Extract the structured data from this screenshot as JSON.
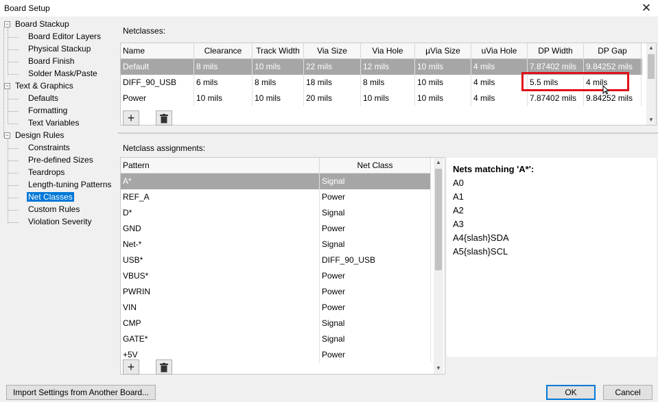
{
  "window": {
    "title": "Board Setup",
    "close_glyph": "✕"
  },
  "tree": [
    {
      "label": "Board Stackup",
      "level": 0,
      "expander": "−"
    },
    {
      "label": "Board Editor Layers",
      "level": 1
    },
    {
      "label": "Physical Stackup",
      "level": 1
    },
    {
      "label": "Board Finish",
      "level": 1
    },
    {
      "label": "Solder Mask/Paste",
      "level": 1
    },
    {
      "label": "Text & Graphics",
      "level": 0,
      "expander": "−"
    },
    {
      "label": "Defaults",
      "level": 1
    },
    {
      "label": "Formatting",
      "level": 1
    },
    {
      "label": "Text Variables",
      "level": 1
    },
    {
      "label": "Design Rules",
      "level": 0,
      "expander": "−"
    },
    {
      "label": "Constraints",
      "level": 1
    },
    {
      "label": "Pre-defined Sizes",
      "level": 1
    },
    {
      "label": "Teardrops",
      "level": 1
    },
    {
      "label": "Length-tuning Patterns",
      "level": 1
    },
    {
      "label": "Net Classes",
      "level": 1,
      "selected": true
    },
    {
      "label": "Custom Rules",
      "level": 1
    },
    {
      "label": "Violation Severity",
      "level": 1
    }
  ],
  "netclasses": {
    "label": "Netclasses:",
    "columns": [
      "Name",
      "Clearance",
      "Track Width",
      "Via Size",
      "Via Hole",
      "µVia Size",
      "uVia Hole",
      "DP Width",
      "DP Gap"
    ],
    "rows": [
      [
        "Default",
        "8 mils",
        "10 mils",
        "22 mils",
        "12 mils",
        "10 mils",
        "4 mils",
        "7.87402 mils",
        "9.84252 mils"
      ],
      [
        "DIFF_90_USB",
        "6 mils",
        "8 mils",
        "18 mils",
        "8 mils",
        "10 mils",
        "4 mils",
        "5.5 mils",
        "4 mils"
      ],
      [
        "Power",
        "10 mils",
        "10 mils",
        "20 mils",
        "10 mils",
        "10 mils",
        "4 mils",
        "7.87402 mils",
        "9.84252 mils"
      ]
    ],
    "selected_row": 0,
    "add_glyph": "+",
    "scroll_up": "▲",
    "scroll_down": "▼"
  },
  "assignments": {
    "label": "Netclass assignments:",
    "columns": [
      "Pattern",
      "Net Class"
    ],
    "rows": [
      [
        "A*",
        "Signal"
      ],
      [
        "REF_A",
        "Power"
      ],
      [
        "D*",
        "Signal"
      ],
      [
        "GND",
        "Power"
      ],
      [
        "Net-*",
        "Signal"
      ],
      [
        "USB*",
        "DIFF_90_USB"
      ],
      [
        "VBUS*",
        "Power"
      ],
      [
        "PWRIN",
        "Power"
      ],
      [
        "VIN",
        "Power"
      ],
      [
        "CMP",
        "Signal"
      ],
      [
        "GATE*",
        "Signal"
      ],
      [
        "+5V",
        "Power"
      ]
    ],
    "selected_row": 0,
    "add_glyph": "+",
    "scroll_up": "▲",
    "scroll_down": "▼"
  },
  "preview": {
    "title": "Nets matching 'A*':",
    "items": [
      "A0",
      "A1",
      "A2",
      "A3",
      "A4{slash}SDA",
      "A5{slash}SCL"
    ]
  },
  "footer": {
    "import_label": "Import Settings from Another Board...",
    "ok_label": "OK",
    "cancel_label": "Cancel"
  },
  "colors": {
    "selection": "#0078d7",
    "row_selected": "#a6a6a6",
    "highlight": "#e0101a"
  }
}
